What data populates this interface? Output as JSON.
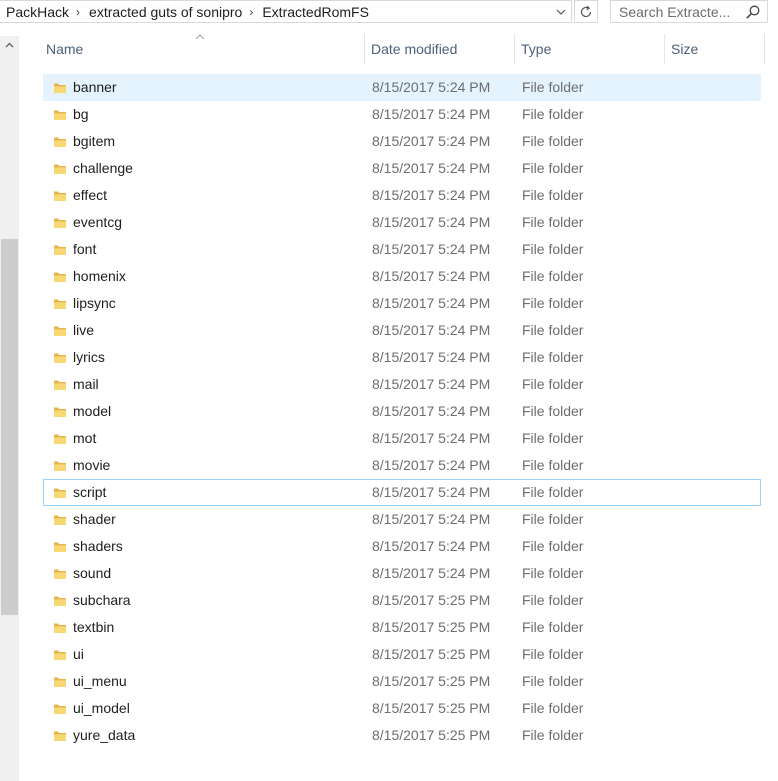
{
  "address_bar": {
    "crumbs": [
      "PackHack",
      "extracted guts of sonipro",
      "ExtractedRomFS"
    ]
  },
  "search": {
    "placeholder": "Search Extracte..."
  },
  "columns": {
    "name": "Name",
    "date_modified": "Date modified",
    "type": "Type",
    "size": "Size"
  },
  "files": [
    {
      "name": "banner",
      "date": "8/15/2017 5:24 PM",
      "type": "File folder",
      "size": ""
    },
    {
      "name": "bg",
      "date": "8/15/2017 5:24 PM",
      "type": "File folder",
      "size": ""
    },
    {
      "name": "bgitem",
      "date": "8/15/2017 5:24 PM",
      "type": "File folder",
      "size": ""
    },
    {
      "name": "challenge",
      "date": "8/15/2017 5:24 PM",
      "type": "File folder",
      "size": ""
    },
    {
      "name": "effect",
      "date": "8/15/2017 5:24 PM",
      "type": "File folder",
      "size": ""
    },
    {
      "name": "eventcg",
      "date": "8/15/2017 5:24 PM",
      "type": "File folder",
      "size": ""
    },
    {
      "name": "font",
      "date": "8/15/2017 5:24 PM",
      "type": "File folder",
      "size": ""
    },
    {
      "name": "homenix",
      "date": "8/15/2017 5:24 PM",
      "type": "File folder",
      "size": ""
    },
    {
      "name": "lipsync",
      "date": "8/15/2017 5:24 PM",
      "type": "File folder",
      "size": ""
    },
    {
      "name": "live",
      "date": "8/15/2017 5:24 PM",
      "type": "File folder",
      "size": ""
    },
    {
      "name": "lyrics",
      "date": "8/15/2017 5:24 PM",
      "type": "File folder",
      "size": ""
    },
    {
      "name": "mail",
      "date": "8/15/2017 5:24 PM",
      "type": "File folder",
      "size": ""
    },
    {
      "name": "model",
      "date": "8/15/2017 5:24 PM",
      "type": "File folder",
      "size": ""
    },
    {
      "name": "mot",
      "date": "8/15/2017 5:24 PM",
      "type": "File folder",
      "size": ""
    },
    {
      "name": "movie",
      "date": "8/15/2017 5:24 PM",
      "type": "File folder",
      "size": ""
    },
    {
      "name": "script",
      "date": "8/15/2017 5:24 PM",
      "type": "File folder",
      "size": ""
    },
    {
      "name": "shader",
      "date": "8/15/2017 5:24 PM",
      "type": "File folder",
      "size": ""
    },
    {
      "name": "shaders",
      "date": "8/15/2017 5:24 PM",
      "type": "File folder",
      "size": ""
    },
    {
      "name": "sound",
      "date": "8/15/2017 5:24 PM",
      "type": "File folder",
      "size": ""
    },
    {
      "name": "subchara",
      "date": "8/15/2017 5:25 PM",
      "type": "File folder",
      "size": ""
    },
    {
      "name": "textbin",
      "date": "8/15/2017 5:25 PM",
      "type": "File folder",
      "size": ""
    },
    {
      "name": "ui",
      "date": "8/15/2017 5:25 PM",
      "type": "File folder",
      "size": ""
    },
    {
      "name": "ui_menu",
      "date": "8/15/2017 5:25 PM",
      "type": "File folder",
      "size": ""
    },
    {
      "name": "ui_model",
      "date": "8/15/2017 5:25 PM",
      "type": "File folder",
      "size": ""
    },
    {
      "name": "yure_data",
      "date": "8/15/2017 5:25 PM",
      "type": "File folder",
      "size": ""
    }
  ],
  "state": {
    "hovered_item": "banner",
    "focused_item": "script"
  },
  "icons": {
    "folder": "folder-icon",
    "search": "search-icon",
    "refresh": "refresh-icon",
    "dropdown": "chevron-down-icon",
    "sort": "sort-ascending-icon",
    "scroll_up": "scroll-up-arrow-icon"
  },
  "colors": {
    "hover_bg": "#e5f3ff",
    "focus_border": "#99d1ff",
    "header_text": "#4c607a",
    "folder_yellow": "#f8d775",
    "muted_text": "#6d6d6d"
  }
}
